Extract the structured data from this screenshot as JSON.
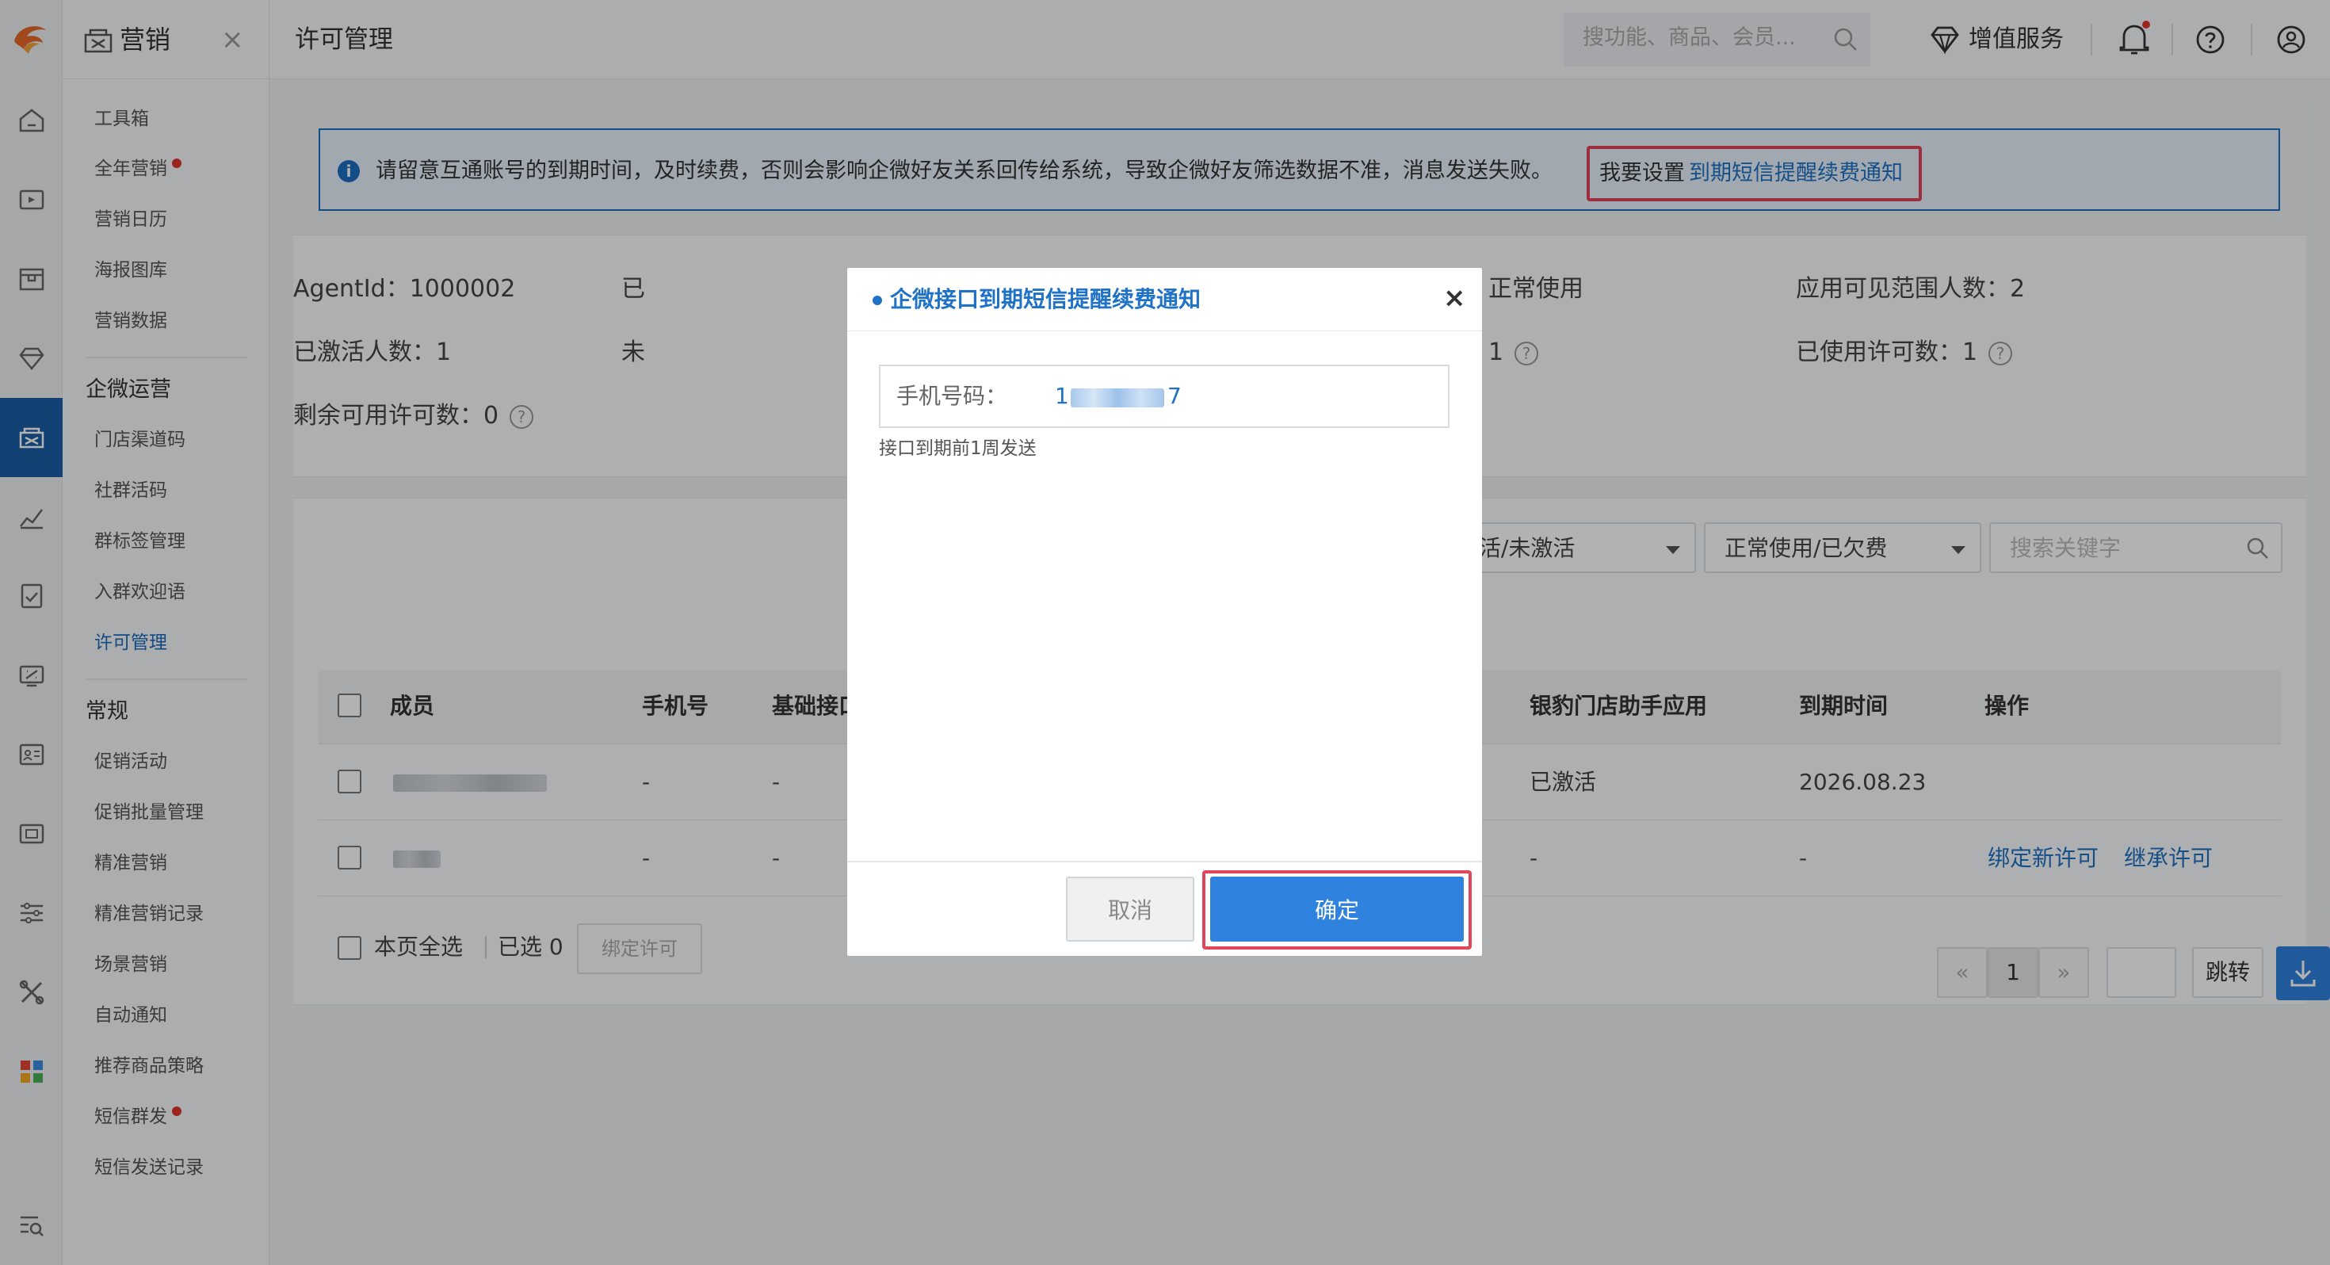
{
  "menu": {
    "title": "营销",
    "close": "×",
    "items": [
      {
        "label": "工具箱"
      },
      {
        "label": "全年营销",
        "badge": true
      },
      {
        "label": "营销日历"
      },
      {
        "label": "海报图库"
      },
      {
        "label": "营销数据"
      }
    ],
    "group1": "企微运营",
    "group1_items": [
      {
        "label": "门店渠道码"
      },
      {
        "label": "社群活码"
      },
      {
        "label": "群标签管理"
      },
      {
        "label": "入群欢迎语"
      },
      {
        "label": "许可管理",
        "active": true
      }
    ],
    "group2": "常规",
    "group2_items": [
      {
        "label": "促销活动"
      },
      {
        "label": "促销批量管理"
      },
      {
        "label": "精准营销"
      },
      {
        "label": "精准营销记录"
      },
      {
        "label": "场景营销"
      },
      {
        "label": "自动通知"
      },
      {
        "label": "推荐商品策略"
      },
      {
        "label": "短信群发",
        "badge": true
      },
      {
        "label": "短信发送记录"
      }
    ]
  },
  "topbar": {
    "page_title": "许可管理",
    "search_placeholder": "搜功能、商品、会员...",
    "vas_label": "增值服务"
  },
  "notice": {
    "icon": "i",
    "text": "请留意互通账号的到期时间，及时续费，否则会影响企微好友关系回传给系统，导致企微好友筛选数据不准，消息发送失败。",
    "prefix": "我要设置",
    "link": "到期短信提醒续费通知"
  },
  "stats": {
    "agent_id": "AgentId：1000002",
    "activated": "已激活人数：1",
    "remaining": "剩余可用许可数：0",
    "col2_row1": "已",
    "col2_row2": "未",
    "col3_row1": "正常使用",
    "col3_row2": "1",
    "visible_range": "应用可见范围人数：2",
    "used": "已使用许可数：1"
  },
  "filters": {
    "activation": "活/未激活",
    "status": "正常使用/已欠费",
    "keyword_placeholder": "搜索关键字"
  },
  "table": {
    "headers": [
      "成员",
      "手机号",
      "基础接口",
      "银豹门店助手应用",
      "到期时间",
      "操作"
    ],
    "rows": [
      {
        "phone": "-",
        "basic": "-",
        "app": "已激活",
        "expire": "2026.08.23",
        "ops": []
      },
      {
        "phone": "-",
        "basic": "-",
        "app": "-",
        "expire": "-",
        "ops": [
          "绑定新许可",
          "继承许可"
        ]
      }
    ]
  },
  "footer": {
    "select_all": "本页全选",
    "selected": "已选 0",
    "bind_button": "绑定许可",
    "prev": "«",
    "page": "1",
    "next": "»",
    "jump": "跳转"
  },
  "dialog": {
    "title": "企微接口到期短信提醒续费通知",
    "close": "×",
    "phone_label": "手机号码：",
    "phone_value_start": "1",
    "phone_value_end": "7",
    "hint": "接口到期前1周发送",
    "cancel": "取消",
    "confirm": "确定"
  },
  "colors": {
    "accent": "#1f72c6",
    "primary_button": "#2f82de",
    "highlight_frame": "#e1455a",
    "sidebar_active": "#1a5fa7"
  }
}
